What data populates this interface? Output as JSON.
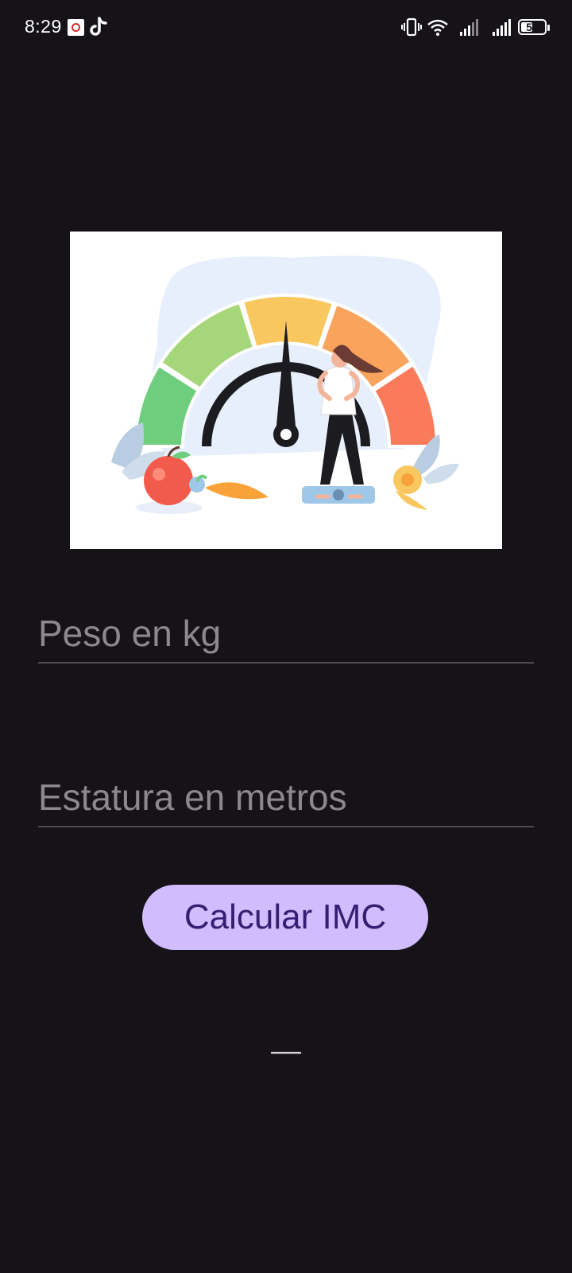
{
  "status_bar": {
    "time": "8:29",
    "battery_level": "57",
    "battery_fraction": 0.57
  },
  "icons": {
    "notification_1": "app-notification-icon",
    "notification_2": "tiktok-icon",
    "vibrate": "vibrate-icon",
    "wifi": "wifi-icon",
    "signal": "signal-icon"
  },
  "form": {
    "peso_placeholder": "Peso en kg",
    "peso_value": "",
    "estatura_placeholder": "Estatura en metros",
    "estatura_value": ""
  },
  "actions": {
    "calculate_label": "Calcular IMC"
  },
  "result": {
    "text": "—"
  },
  "colors": {
    "background": "#151218",
    "button": "#d0bcff",
    "button_text": "#381e72",
    "gauge": [
      "#6fce7e",
      "#a6d67a",
      "#f9c75f",
      "#f9a35c",
      "#f97b5b"
    ]
  }
}
